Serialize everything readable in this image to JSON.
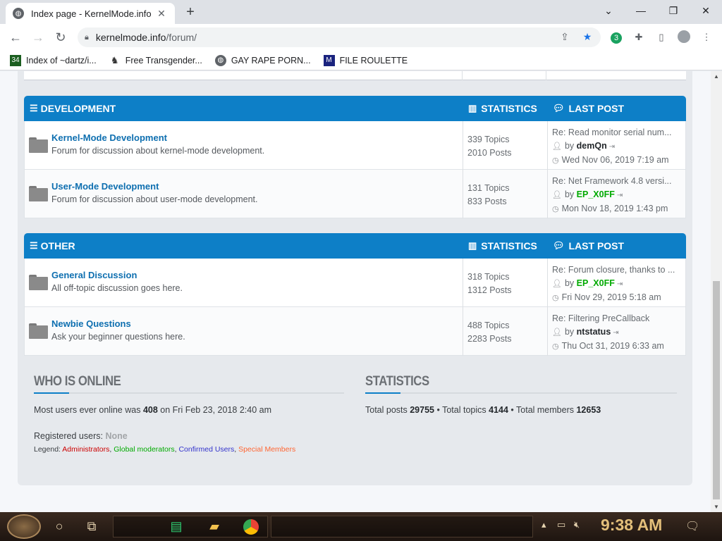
{
  "browser": {
    "tab_title": "Index page - KernelMode.info",
    "url_host": "kernelmode.info",
    "url_path": "/forum/",
    "bookmarks": [
      {
        "label": "Index of ~dartz/i...",
        "icon": "site-icon"
      },
      {
        "label": "Free Transgender...",
        "icon": "site-icon"
      },
      {
        "label": "GAY RAPE PORN...",
        "icon": "globe-icon"
      },
      {
        "label": "FILE ROULETTE",
        "icon": "site-icon"
      }
    ],
    "extension_badge": "3"
  },
  "categories": [
    {
      "name": "DEVELOPMENT",
      "stats_label": "STATISTICS",
      "lastpost_label": "LAST POST",
      "forums": [
        {
          "name": "Kernel-Mode Development",
          "desc": "Forum for discussion about kernel-mode development.",
          "topics": "339 Topics",
          "posts": "2010 Posts",
          "last_title": "Re: Read monitor serial num...",
          "last_by": "by",
          "last_user": "demQn",
          "user_color": "default",
          "last_date": "Wed Nov 06, 2019 7:19 am"
        },
        {
          "name": "User-Mode Development",
          "desc": "Forum for discussion about user-mode development.",
          "topics": "131 Topics",
          "posts": "833 Posts",
          "last_title": "Re: Net Framework 4.8 versi...",
          "last_by": "by",
          "last_user": "EP_X0FF",
          "user_color": "green",
          "last_date": "Mon Nov 18, 2019 1:43 pm"
        }
      ]
    },
    {
      "name": "OTHER",
      "stats_label": "STATISTICS",
      "lastpost_label": "LAST POST",
      "forums": [
        {
          "name": "General Discussion",
          "desc": "All off-topic discussion goes here.",
          "topics": "318 Topics",
          "posts": "1312 Posts",
          "last_title": "Re: Forum closure, thanks to ...",
          "last_by": "by",
          "last_user": "EP_X0FF",
          "user_color": "green",
          "last_date": "Fri Nov 29, 2019 5:18 am"
        },
        {
          "name": "Newbie Questions",
          "desc": "Ask your beginner questions here.",
          "topics": "488 Topics",
          "posts": "2283 Posts",
          "last_title": "Re: Filtering PreCallback",
          "last_by": "by",
          "last_user": "ntstatus",
          "user_color": "default",
          "last_date": "Thu Oct 31, 2019 6:33 am"
        }
      ]
    }
  ],
  "who_is_online": {
    "title": "WHO IS ONLINE",
    "text_prefix": "Most users ever online was ",
    "count": "408",
    "text_mid": " on Fri Feb 23, 2018 2:40 am",
    "registered_label": "Registered users: ",
    "registered_value": "None",
    "legend_label": "Legend: ",
    "legend": [
      {
        "label": "Administrators",
        "color": "#cc0000"
      },
      {
        "label": "Global moderators",
        "color": "#00aa00"
      },
      {
        "label": "Confirmed Users",
        "color": "#3333cc"
      },
      {
        "label": "Special Members",
        "color": "#ff6633"
      }
    ]
  },
  "statistics": {
    "title": "STATISTICS",
    "posts_label": "Total posts ",
    "posts": "29755",
    "topics_label": " • Total topics ",
    "topics": "4144",
    "members_label": " • Total members ",
    "members": "12653"
  },
  "taskbar": {
    "clock": "9:38 AM"
  },
  "colors": {
    "accent": "#0d7fc7",
    "forum_link": "#0e6fb0",
    "green_user": "#00aa00"
  }
}
